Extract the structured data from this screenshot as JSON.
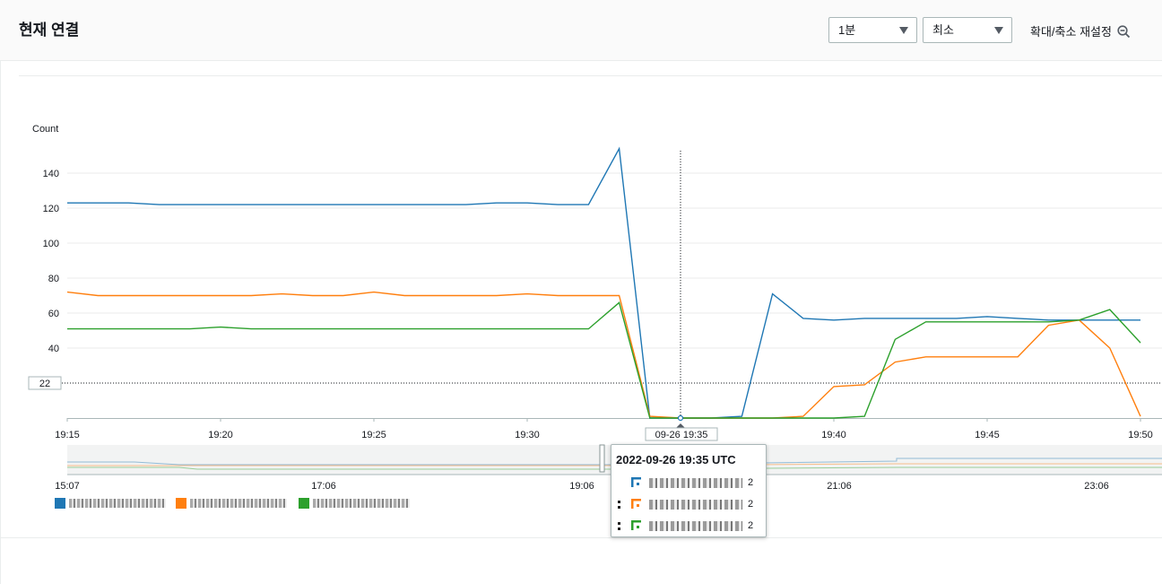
{
  "header": {
    "title": "현재 연결",
    "period_select": "1분",
    "stat_select": "최소",
    "zoom_reset_label": "확대/축소 재설정"
  },
  "colors": {
    "series1": "#1f77b4",
    "series2": "#ff7f0e",
    "series3": "#2ca02c"
  },
  "chart_data": {
    "type": "line",
    "ylabel": "Count",
    "y_ticks": [
      "140",
      "120",
      "100",
      "80",
      "60",
      "40"
    ],
    "ylim": [
      0,
      150
    ],
    "x_ticks": [
      "19:15",
      "19:20",
      "19:25",
      "19:30",
      "19:40",
      "19:45",
      "19:50"
    ],
    "x_range": [
      "19:15",
      "19:50"
    ],
    "threshold_label": "22",
    "threshold_value": 20,
    "cursor_label": "09-26 19:35",
    "cursor_time": "19:35",
    "x": [
      "19:15",
      "19:16",
      "19:17",
      "19:18",
      "19:19",
      "19:20",
      "19:21",
      "19:22",
      "19:23",
      "19:24",
      "19:25",
      "19:26",
      "19:27",
      "19:28",
      "19:29",
      "19:30",
      "19:31",
      "19:32",
      "19:33",
      "19:34",
      "19:35",
      "19:36",
      "19:37",
      "19:38",
      "19:39",
      "19:40",
      "19:41",
      "19:42",
      "19:43",
      "19:44",
      "19:45",
      "19:46",
      "19:47",
      "19:48",
      "19:49",
      "19:50"
    ],
    "series": [
      {
        "values": [
          123,
          123,
          123,
          122,
          122,
          122,
          122,
          122,
          122,
          122,
          122,
          122,
          122,
          122,
          123,
          123,
          122,
          122,
          154,
          0,
          0,
          0,
          1,
          71,
          57,
          56,
          57,
          57,
          57,
          57,
          58,
          57,
          56,
          56,
          56,
          56
        ]
      },
      {
        "values": [
          72,
          70,
          70,
          70,
          70,
          70,
          70,
          71,
          70,
          70,
          72,
          70,
          70,
          70,
          70,
          71,
          70,
          70,
          70,
          1,
          0,
          0,
          0,
          0,
          1,
          18,
          19,
          32,
          35,
          35,
          35,
          35,
          53,
          56,
          40,
          1
        ]
      },
      {
        "values": [
          51,
          51,
          51,
          51,
          51,
          52,
          51,
          51,
          51,
          51,
          51,
          51,
          51,
          51,
          51,
          51,
          51,
          51,
          66,
          0,
          0,
          0,
          0,
          0,
          0,
          0,
          1,
          45,
          55,
          55,
          55,
          55,
          55,
          56,
          62,
          43
        ]
      }
    ],
    "overview": {
      "x_ticks": [
        "15:07",
        "17:06",
        "19:06",
        "21:06",
        "23:06"
      ]
    },
    "tooltip": {
      "title": "2022-09-26 19:35 UTC",
      "values": [
        "2",
        "2",
        "2"
      ]
    }
  }
}
